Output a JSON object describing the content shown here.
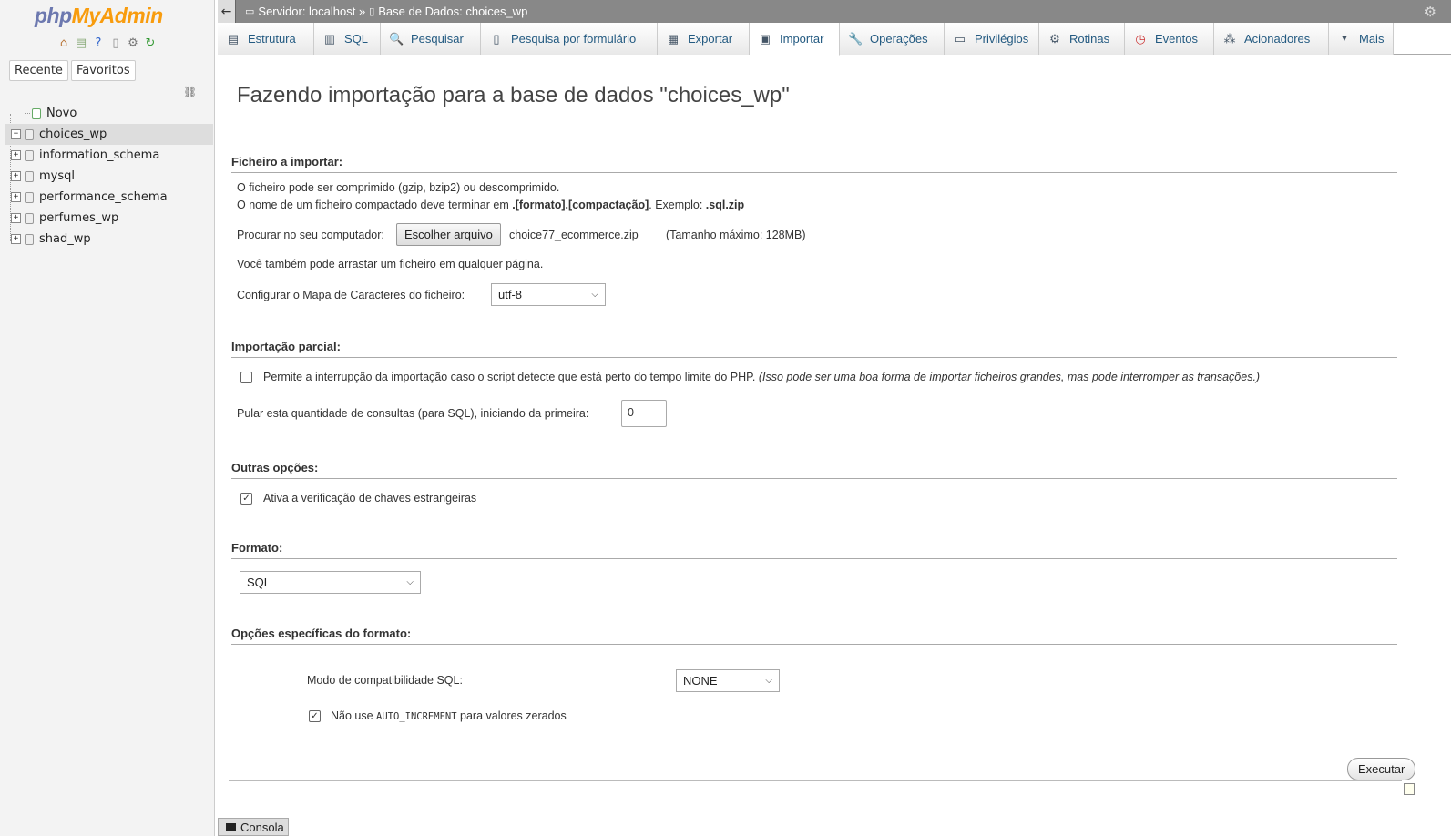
{
  "logo": {
    "part1": "php",
    "part2": "MyAdmin"
  },
  "quick_icons": [
    "home-icon",
    "log-icon",
    "help-icon",
    "docs-icon",
    "settings-icon",
    "reload-icon"
  ],
  "nav_tabs": {
    "recent": "Recente",
    "favorites": "Favoritos"
  },
  "tree": [
    {
      "label": "Novo",
      "expander": ""
    },
    {
      "label": "choices_wp",
      "expander": "−"
    },
    {
      "label": "information_schema",
      "expander": "+"
    },
    {
      "label": "mysql",
      "expander": "+"
    },
    {
      "label": "performance_schema",
      "expander": "+"
    },
    {
      "label": "perfumes_wp",
      "expander": "+"
    },
    {
      "label": "shad_wp",
      "expander": "+"
    }
  ],
  "breadcrumb": {
    "server": "Servidor: localhost »",
    "database": "Base de Dados: choices_wp"
  },
  "menu": [
    {
      "label": "Estrutura",
      "icon": "▤"
    },
    {
      "label": "SQL",
      "icon": "▥"
    },
    {
      "label": "Pesquisar",
      "icon": "🔍"
    },
    {
      "label": "Pesquisa por formulário",
      "icon": "▯"
    },
    {
      "label": "Exportar",
      "icon": "▦"
    },
    {
      "label": "Importar",
      "icon": "▣"
    },
    {
      "label": "Operações",
      "icon": "🔧"
    },
    {
      "label": "Privilégios",
      "icon": "▭"
    },
    {
      "label": "Rotinas",
      "icon": "⚙"
    },
    {
      "label": "Eventos",
      "icon": "◷"
    },
    {
      "label": "Acionadores",
      "icon": "⁂"
    },
    {
      "label": "Mais",
      "icon": "▼"
    }
  ],
  "page_title": "Fazendo importação para a base de dados \"choices_wp\"",
  "file_section": {
    "title": "Ficheiro a importar:",
    "line1": "O ficheiro pode ser comprimido (gzip, bzip2) ou descomprimido.",
    "line2_pre": "O nome de um ficheiro compactado deve terminar em ",
    "line2_bold": ".[formato].[compactação]",
    "line2_mid": ". Exemplo: ",
    "line2_ex": ".sql.zip",
    "browse_label": "Procurar no seu computador:",
    "choose_button": "Escolher arquivo",
    "file_name": "choice77_ecommerce.zip",
    "max_size": "(Tamanho máximo: 128MB)",
    "drag_note": "Você também pode arrastar um ficheiro em qualquer página.",
    "charset_label": "Configurar o Mapa de Caracteres do ficheiro:",
    "charset_value": "utf-8"
  },
  "partial_section": {
    "title": "Importação parcial:",
    "allow_interrupt": "Permite a interrupção da importação caso o script detecte que está perto do tempo limite do PHP.",
    "allow_interrupt_note": "(Isso pode ser uma boa forma de importar ficheiros grandes, mas pode interromper as transações.)",
    "allow_interrupt_checked": false,
    "skip_label": "Pular esta quantidade de consultas (para SQL), iniciando da primeira:",
    "skip_value": "0"
  },
  "other_section": {
    "title": "Outras opções:",
    "fk_label": "Ativa a verificação de chaves estrangeiras",
    "fk_checked": true
  },
  "format_section": {
    "title": "Formato:",
    "format_value": "SQL"
  },
  "format_options_section": {
    "title": "Opções específicas do formato:",
    "compat_label": "Modo de compatibilidade SQL:",
    "compat_value": "NONE",
    "no_auto_pre": "Não use ",
    "no_auto_code": "AUTO_INCREMENT",
    "no_auto_post": " para valores zerados",
    "no_auto_checked": true
  },
  "execute_button": "Executar",
  "console_label": "Consola"
}
